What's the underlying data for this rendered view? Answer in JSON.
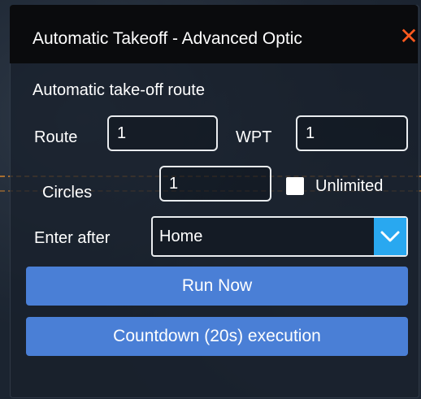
{
  "window": {
    "title": "Automatic Takeoff - Advanced Optic",
    "close_icon": "✕",
    "close_color": "#ff5a1f"
  },
  "section": {
    "title": "Automatic take-off route"
  },
  "route": {
    "label": "Route",
    "value": "1"
  },
  "wpt": {
    "label": "WPT",
    "value": "1"
  },
  "circles": {
    "label": "Circles",
    "value": "1"
  },
  "unlimited": {
    "label": "Unlimited",
    "checked": false
  },
  "enter_after": {
    "label": "Enter after",
    "selected": "Home"
  },
  "buttons": {
    "run_now": "Run Now",
    "countdown": "Countdown (20s) execution"
  },
  "colors": {
    "accent": "#4a7fd6",
    "dropdown_arrow_bg": "#29a8f0",
    "title_bar": "#0a0b0d"
  },
  "icons": {
    "close": "close-icon",
    "dropdown": "chevron-down-icon"
  }
}
